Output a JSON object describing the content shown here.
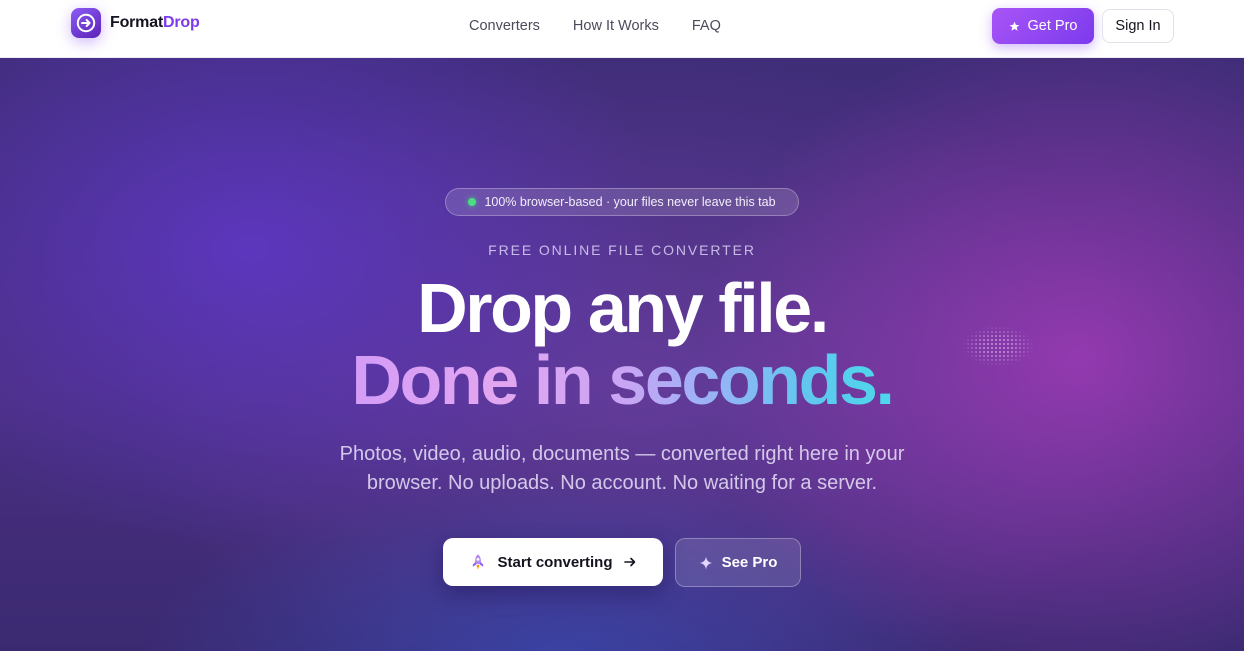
{
  "brand": {
    "name_part1": "Format",
    "name_part2": "Drop",
    "accent_color": "#7c3aed"
  },
  "nav": {
    "links": [
      "Converters",
      "How It Works",
      "FAQ"
    ],
    "get_pro_label": "Get Pro",
    "sign_in_label": "Sign In"
  },
  "hero": {
    "badge_text": "100% browser-based · your files never leave this tab",
    "eyebrow": "FREE ONLINE FILE CONVERTER",
    "headline_line1": "Drop any file.",
    "headline_line2": "Done in seconds",
    "headline_period": ".",
    "subtitle_line1": "Photos, video, audio, documents — converted right here in your",
    "subtitle_line2": "browser. No uploads. No account. No waiting for a server.",
    "primary_cta": "Start converting",
    "secondary_cta": "See Pro"
  },
  "icons": {
    "logo": "arrow-right-circle-icon",
    "get_pro": "star-icon",
    "start": "rocket-icon",
    "start_arrow": "arrow-right-icon",
    "see_pro": "sparkle-icon"
  },
  "colors": {
    "badge_dot": "#4ade80",
    "pro_gradient_start": "#a855f7",
    "pro_gradient_end": "#7c3aed",
    "headline_gradient_end": "#4fd6ec"
  }
}
